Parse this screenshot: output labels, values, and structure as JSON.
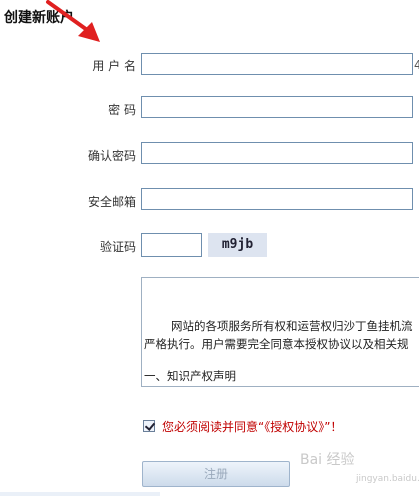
{
  "page": {
    "title": "创建新账户"
  },
  "form": {
    "username_label": "用 户 名",
    "password_label": "密 码",
    "confirm_password_label": "确认密码",
    "email_label": "安全邮箱",
    "captcha_label": "验证码",
    "captcha_code": "m9jb",
    "username_value": "",
    "password_value": "",
    "confirm_password_value": "",
    "email_value": "",
    "captcha_value": ""
  },
  "agreement": {
    "line1": "网站的各项服务所有权和运营权归沙丁鱼挂机流",
    "line2": "严格执行。用户需要完全同意本授权协议以及相关规",
    "line3": "一、知识产权声明"
  },
  "consent": {
    "text": "您必须阅读并同意“《授权协议》”！",
    "checked": true
  },
  "submit": {
    "label": "注册"
  },
  "watermark": {
    "text": "Bai 经验",
    "sub": "jingyan.baidu.com"
  },
  "edge_glyph": "4",
  "colors": {
    "arrow": "#e02020",
    "consent_text": "#c00000",
    "input_border": "#6f8fae"
  }
}
